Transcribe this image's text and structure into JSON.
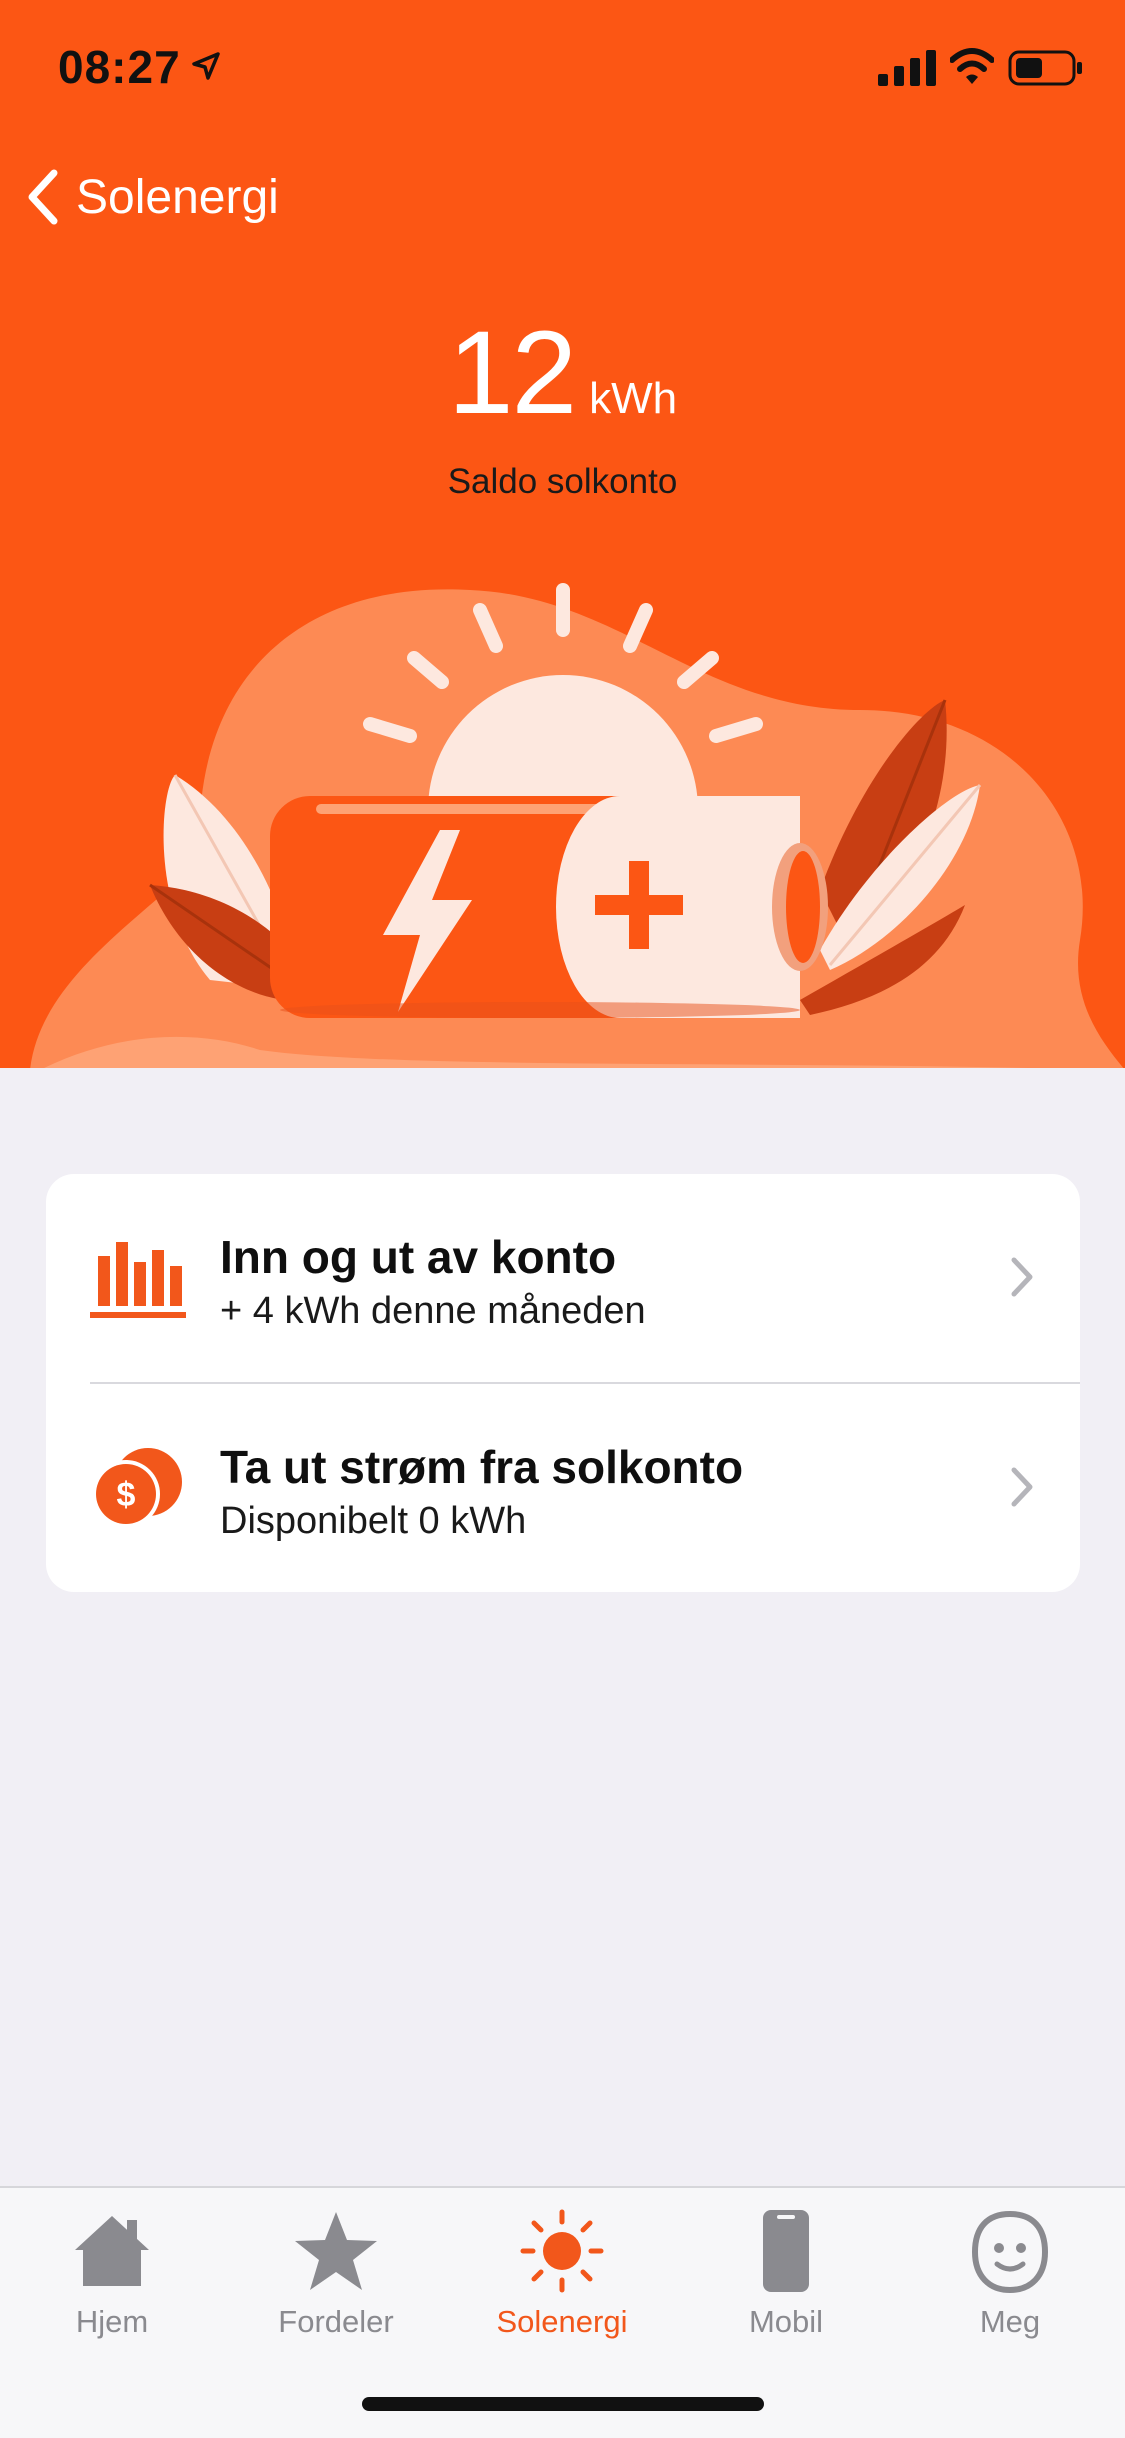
{
  "status_bar": {
    "time": "08:27"
  },
  "nav": {
    "back_label": "Solenergi"
  },
  "balance": {
    "value": "12",
    "unit": "kWh",
    "caption": "Saldo solkonto"
  },
  "list": [
    {
      "title": "Inn og ut av konto",
      "subtitle": "+ 4 kWh denne måneden",
      "icon": "bar-chart-icon"
    },
    {
      "title": "Ta ut strøm fra solkonto",
      "subtitle": "Disponibelt 0 kWh",
      "icon": "coin-exchange-icon"
    }
  ],
  "tabs": [
    {
      "label": "Hjem",
      "icon": "home-icon"
    },
    {
      "label": "Fordeler",
      "icon": "star-icon"
    },
    {
      "label": "Solenergi",
      "icon": "sun-icon",
      "active": true
    },
    {
      "label": "Mobil",
      "icon": "phone-icon"
    },
    {
      "label": "Meg",
      "icon": "face-icon"
    }
  ],
  "colors": {
    "accent": "#fc5614",
    "background": "#f1eff5",
    "tab_inactive": "#8a8a8f",
    "tab_active": "#f2571b"
  }
}
